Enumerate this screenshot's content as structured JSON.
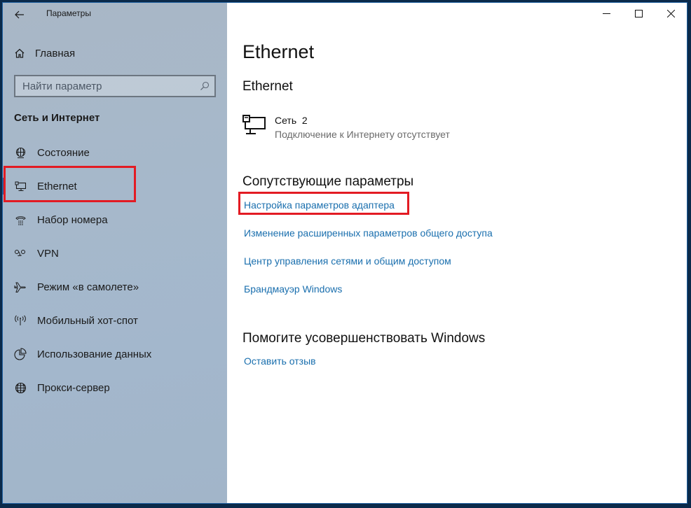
{
  "window": {
    "app_title": "Параметры",
    "controls": {
      "minimize": "minimize-icon",
      "maximize": "maximize-icon",
      "close": "close-icon"
    }
  },
  "sidebar": {
    "back_icon": "arrow-left-icon",
    "home": {
      "label": "Главная",
      "icon": "home-icon"
    },
    "search": {
      "placeholder": "Найти параметр",
      "value": "",
      "icon": "search-icon"
    },
    "section_title": "Сеть и Интернет",
    "items": [
      {
        "label": "Состояние",
        "icon": "globe-status-icon",
        "active": false
      },
      {
        "label": "Ethernet",
        "icon": "ethernet-icon",
        "active": true,
        "highlighted": true
      },
      {
        "label": "Набор номера",
        "icon": "dial-up-icon",
        "active": false
      },
      {
        "label": "VPN",
        "icon": "vpn-icon",
        "active": false
      },
      {
        "label": "Режим «в самолете»",
        "icon": "airplane-icon",
        "active": false
      },
      {
        "label": "Мобильный хот-спот",
        "icon": "hotspot-icon",
        "active": false
      },
      {
        "label": "Использование данных",
        "icon": "data-usage-icon",
        "active": false
      },
      {
        "label": "Прокси-сервер",
        "icon": "globe-icon",
        "active": false
      }
    ]
  },
  "main": {
    "page_title": "Ethernet",
    "subtitle": "Ethernet",
    "network": {
      "name": "Сеть  2",
      "status": "Подключение к Интернету отсутствует",
      "icon": "ethernet-monitor-icon"
    },
    "related": {
      "title": "Сопутствующие параметры",
      "links": [
        {
          "label": "Настройка параметров адаптера",
          "highlighted": true
        },
        {
          "label": "Изменение расширенных параметров общего доступа"
        },
        {
          "label": "Центр управления сетями и общим доступом"
        },
        {
          "label": "Брандмауэр Windows"
        }
      ]
    },
    "help": {
      "title": "Помогите усовершенствовать Windows",
      "link": "Оставить отзыв"
    }
  },
  "colors": {
    "link": "#1a6fae",
    "highlight": "#e31b23",
    "sidebar_bg": "#a6b8cb"
  }
}
